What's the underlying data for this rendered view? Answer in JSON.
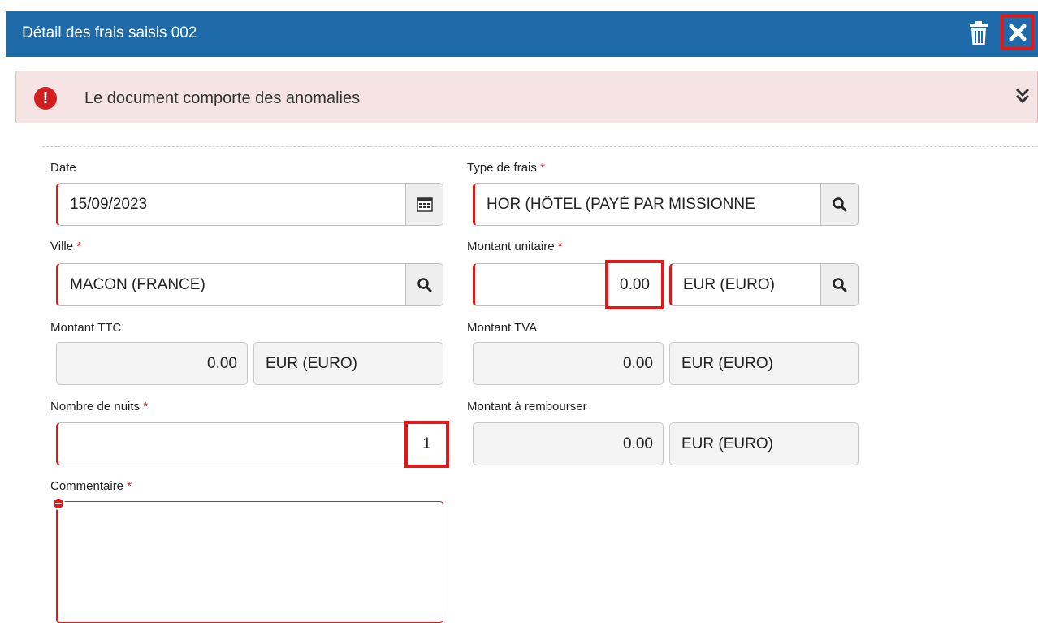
{
  "header": {
    "title": "Détail des frais saisis 002"
  },
  "alert": {
    "message": "Le document comporte des anomalies"
  },
  "form": {
    "date": {
      "label": "Date",
      "value": "15/09/2023"
    },
    "type_frais": {
      "label": "Type de frais",
      "required_mark": "*",
      "value": "HOR (HÔTEL (PAYÉ PAR MISSIONNE"
    },
    "ville": {
      "label": "Ville",
      "required_mark": "*",
      "value": "MACON (FRANCE)"
    },
    "montant_unitaire": {
      "label": "Montant unitaire",
      "required_mark": "*",
      "value": "0.00",
      "currency": "EUR (EURO)"
    },
    "montant_ttc": {
      "label": "Montant TTC",
      "value": "0.00",
      "currency": "EUR (EURO)"
    },
    "montant_tva": {
      "label": "Montant TVA",
      "value": "0.00",
      "currency": "EUR (EURO)"
    },
    "nombre_nuits": {
      "label": "Nombre de nuits",
      "required_mark": "*",
      "value": "1"
    },
    "montant_rembourser": {
      "label": "Montant à rembourser",
      "value": "0.00",
      "currency": "EUR (EURO)"
    },
    "commentaire": {
      "label": "Commentaire",
      "required_mark": "*",
      "value": ""
    }
  },
  "colors": {
    "header_bg": "#1f6aa8",
    "alert_bg": "#f6e3e3",
    "error_red": "#d41e1e",
    "highlight_red": "#e01a1a"
  }
}
